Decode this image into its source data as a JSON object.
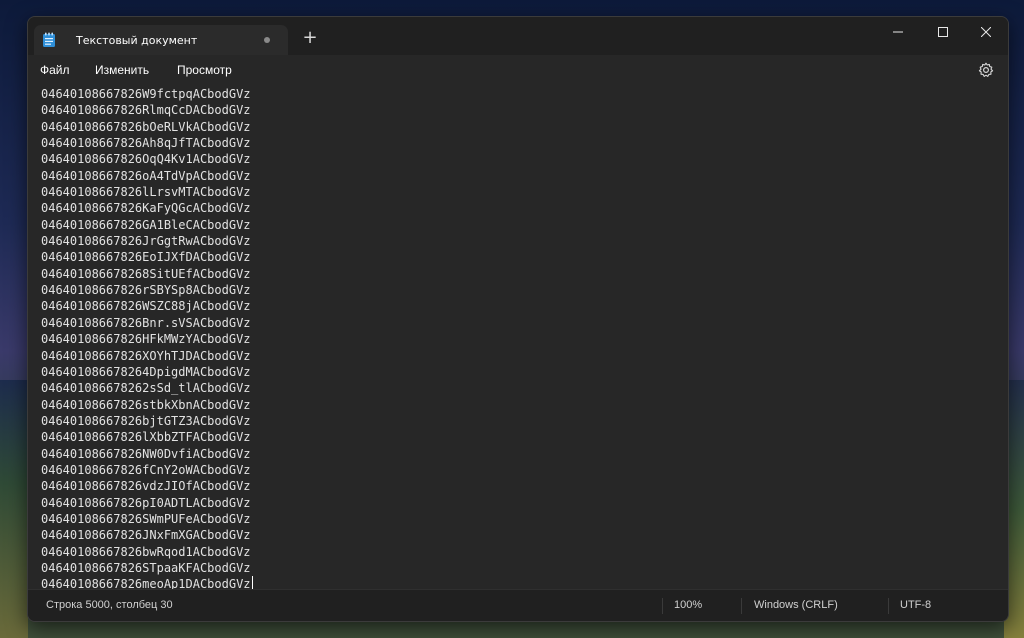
{
  "window": {
    "tab_title": "Текстовый документ",
    "new_tab_symbol": "+",
    "minimize_icon": "minimize-icon",
    "maximize_icon": "maximize-icon",
    "close_icon": "close-icon"
  },
  "menu": {
    "file": "Файл",
    "edit": "Изменить",
    "view": "Просмотр",
    "settings_icon": "gear-icon"
  },
  "editor": {
    "lines": [
      "04640108667826W9fctpqACbodGVz",
      "04640108667826RlmqCcDACbodGVz",
      "04640108667826bOeRLVkACbodGVz",
      "04640108667826Ah8qJfTACbodGVz",
      "04640108667826OqQ4Kv1ACbodGVz",
      "04640108667826oA4TdVpACbodGVz",
      "04640108667826lLrsvMTACbodGVz",
      "04640108667826KaFyQGcACbodGVz",
      "04640108667826GA1BleCACbodGVz",
      "04640108667826JrGgtRwACbodGVz",
      "04640108667826EoIJXfDACbodGVz",
      "046401086678268SitUEfACbodGVz",
      "04640108667826rSBYSp8ACbodGVz",
      "04640108667826WSZC88jACbodGVz",
      "04640108667826Bnr.sVSACbodGVz",
      "04640108667826HFkMWzYACbodGVz",
      "04640108667826XOYhTJDACbodGVz",
      "046401086678264DpigdMACbodGVz",
      "046401086678262sSd_tlACbodGVz",
      "04640108667826stbkXbnACbodGVz",
      "04640108667826bjtGTZ3ACbodGVz",
      "04640108667826lXbbZTFACbodGVz",
      "04640108667826NW0DvfiACbodGVz",
      "04640108667826fCnY2oWACbodGVz",
      "04640108667826vdzJIOfACbodGVz",
      "04640108667826pI0ADTLACbodGVz",
      "04640108667826SWmPUFeACbodGVz",
      "04640108667826JNxFmXGACbodGVz",
      "04640108667826bwRqod1ACbodGVz",
      "04640108667826STpaaKFACbodGVz",
      "04640108667826meoAp1DACbodGVz"
    ]
  },
  "status": {
    "position": "Строка 5000, столбец 30",
    "zoom": "100%",
    "line_endings": "Windows (CRLF)",
    "encoding": "UTF-8"
  },
  "colors": {
    "window_bg": "#272727",
    "titlebar_bg": "#202020",
    "text": "#e2e2e2",
    "notepad_icon_blue": "#2f8fd8"
  }
}
